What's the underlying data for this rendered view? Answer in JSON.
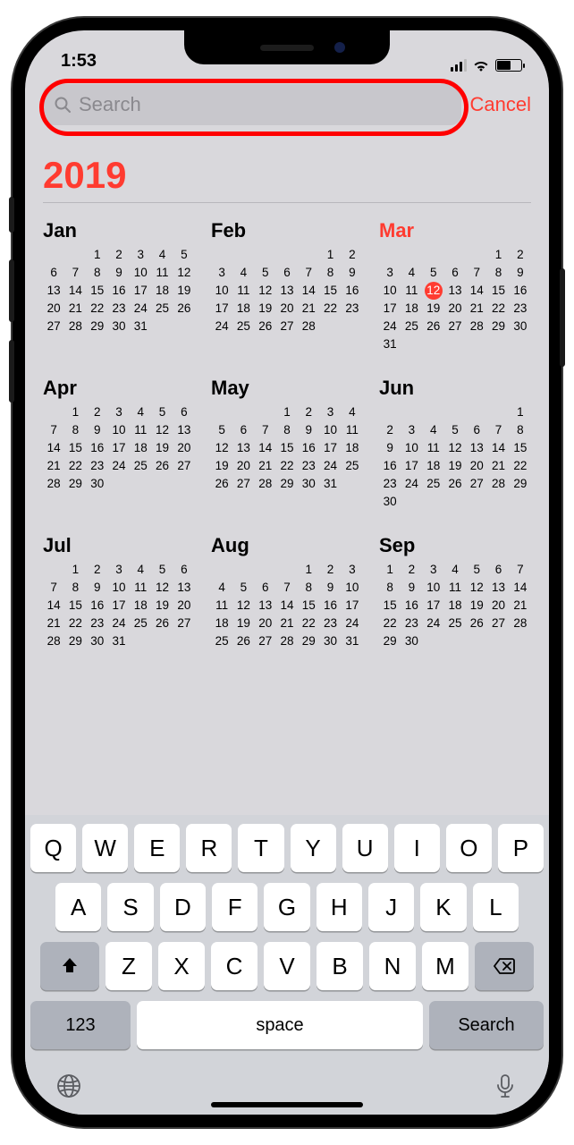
{
  "status": {
    "time": "1:53"
  },
  "search": {
    "placeholder": "Search",
    "cancel": "Cancel"
  },
  "year": "2019",
  "today": {
    "month": "Mar",
    "day": 12
  },
  "months": [
    {
      "name": "Jan",
      "start": 2,
      "days": 31
    },
    {
      "name": "Feb",
      "start": 5,
      "days": 28
    },
    {
      "name": "Mar",
      "start": 5,
      "days": 31
    },
    {
      "name": "Apr",
      "start": 1,
      "days": 30
    },
    {
      "name": "May",
      "start": 3,
      "days": 31
    },
    {
      "name": "Jun",
      "start": 6,
      "days": 30
    },
    {
      "name": "Jul",
      "start": 1,
      "days": 31
    },
    {
      "name": "Aug",
      "start": 4,
      "days": 31
    },
    {
      "name": "Sep",
      "start": 0,
      "days": 30
    }
  ],
  "keyboard": {
    "row1": [
      "Q",
      "W",
      "E",
      "R",
      "T",
      "Y",
      "U",
      "I",
      "O",
      "P"
    ],
    "row2": [
      "A",
      "S",
      "D",
      "F",
      "G",
      "H",
      "J",
      "K",
      "L"
    ],
    "row3": [
      "Z",
      "X",
      "C",
      "V",
      "B",
      "N",
      "M"
    ],
    "numKey": "123",
    "spaceKey": "space",
    "searchKey": "Search"
  }
}
